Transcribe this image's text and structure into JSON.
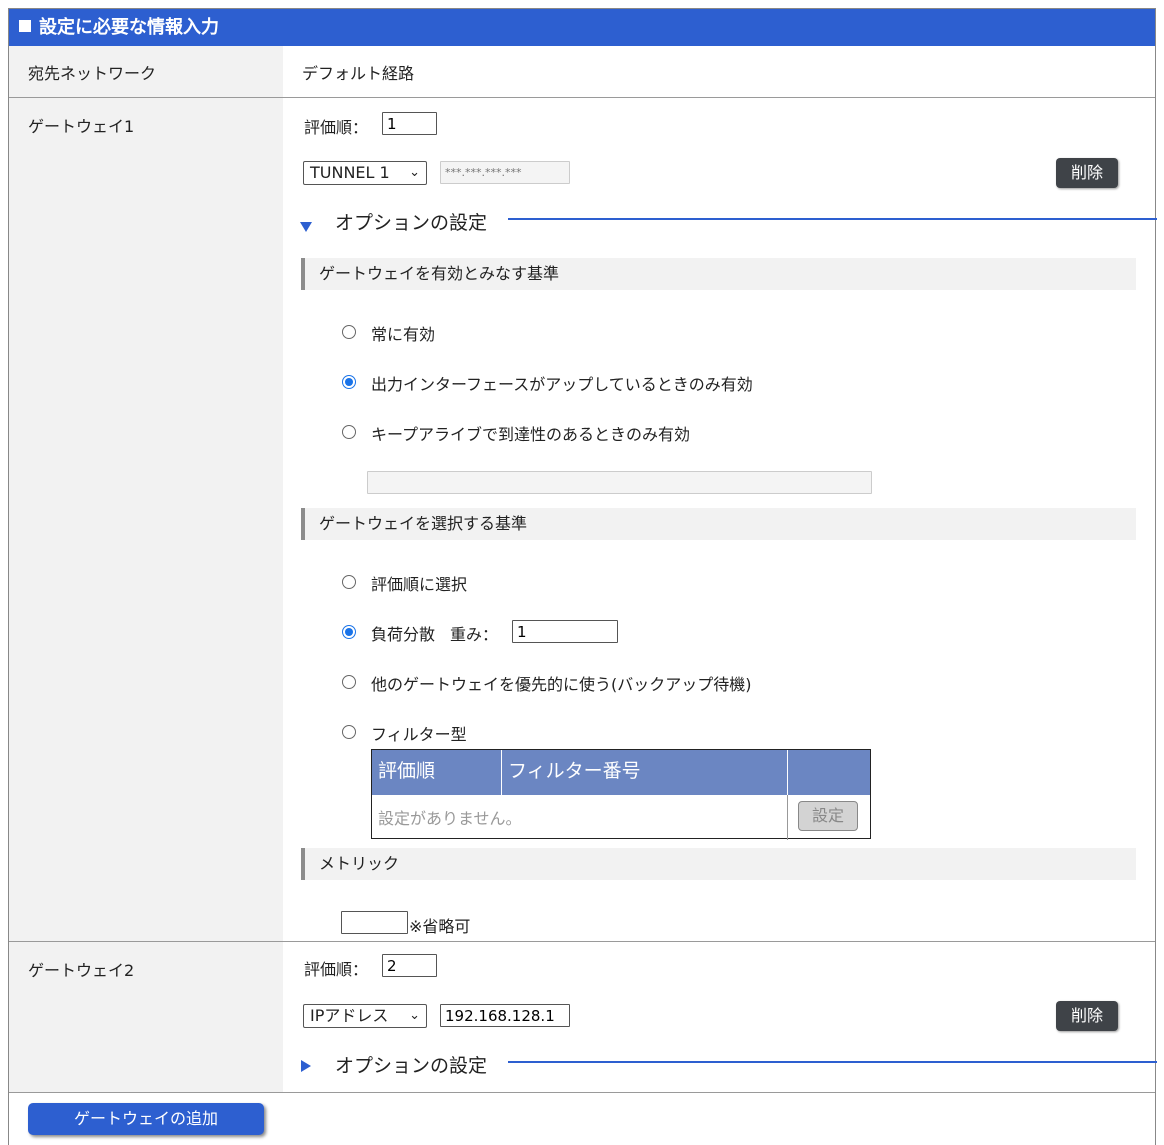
{
  "header": {
    "title": "設定に必要な情報入力"
  },
  "destination": {
    "label": "宛先ネットワーク",
    "value": "デフォルト経路"
  },
  "gateway1": {
    "label": "ゲートウェイ1",
    "priority_label": "評価順：",
    "priority_value": "1",
    "type_selected": "TUNNEL 1",
    "address_placeholder": "***.***.***.***",
    "delete_label": "削除",
    "options_label": "オプションの設定",
    "valid_section": {
      "title": "ゲートウェイを有効とみなす基準",
      "options": [
        "常に有効",
        "出力インターフェースがアップしているときのみ有効",
        "キープアライブで到達性のあるときのみ有効"
      ],
      "selected_index": 1
    },
    "select_section": {
      "title": "ゲートウェイを選択する基準",
      "options": [
        "評価順に選択",
        "負荷分散",
        "他のゲートウェイを優先的に使う(バックアップ待機)",
        "フィルター型"
      ],
      "selected_index": 1,
      "weight_label": "重み：",
      "weight_value": "1"
    },
    "filter_table": {
      "columns": [
        "評価順",
        "フィルター番号",
        ""
      ],
      "empty_text": "設定がありません。",
      "set_button": "設定"
    },
    "metric_section": {
      "title": "メトリック",
      "note": "※省略可",
      "value": ""
    }
  },
  "gateway2": {
    "label": "ゲートウェイ2",
    "priority_label": "評価順：",
    "priority_value": "2",
    "type_selected": "IPアドレス",
    "address_value": "192.168.128.1",
    "delete_label": "削除",
    "options_label": "オプションの設定"
  },
  "add_gateway_button": "ゲートウェイの追加"
}
